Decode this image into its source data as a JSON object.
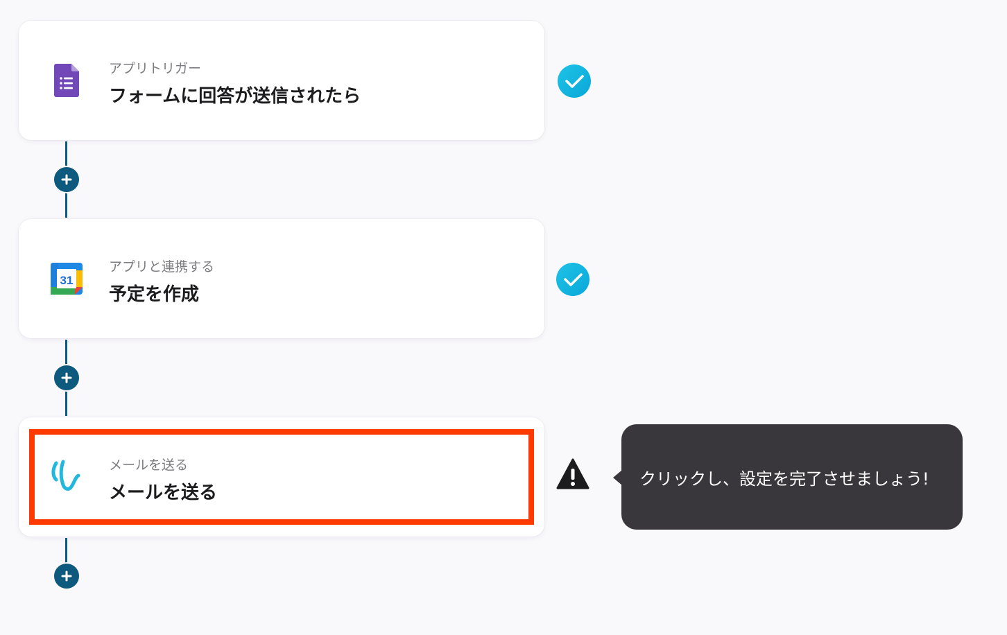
{
  "steps": [
    {
      "subtitle": "アプリトリガー",
      "title": "フォームに回答が送信されたら",
      "icon": "google-forms-icon",
      "status": "complete"
    },
    {
      "subtitle": "アプリと連携する",
      "title": "予定を作成",
      "icon": "google-calendar-icon",
      "icon_text": "31",
      "status": "complete"
    },
    {
      "subtitle": "メールを送る",
      "title": "メールを送る",
      "icon": "mail-send-icon",
      "status": "warning"
    }
  ],
  "tooltip": {
    "text": "クリックし、設定を完了させましょう!"
  },
  "colors": {
    "connector": "#0e5a7e",
    "check_gradient_start": "#1ec3e6",
    "check_gradient_end": "#0aa7d9",
    "highlight": "#ff3a00",
    "tooltip_bg": "#39373b",
    "forms_purple": "#7248b9"
  }
}
